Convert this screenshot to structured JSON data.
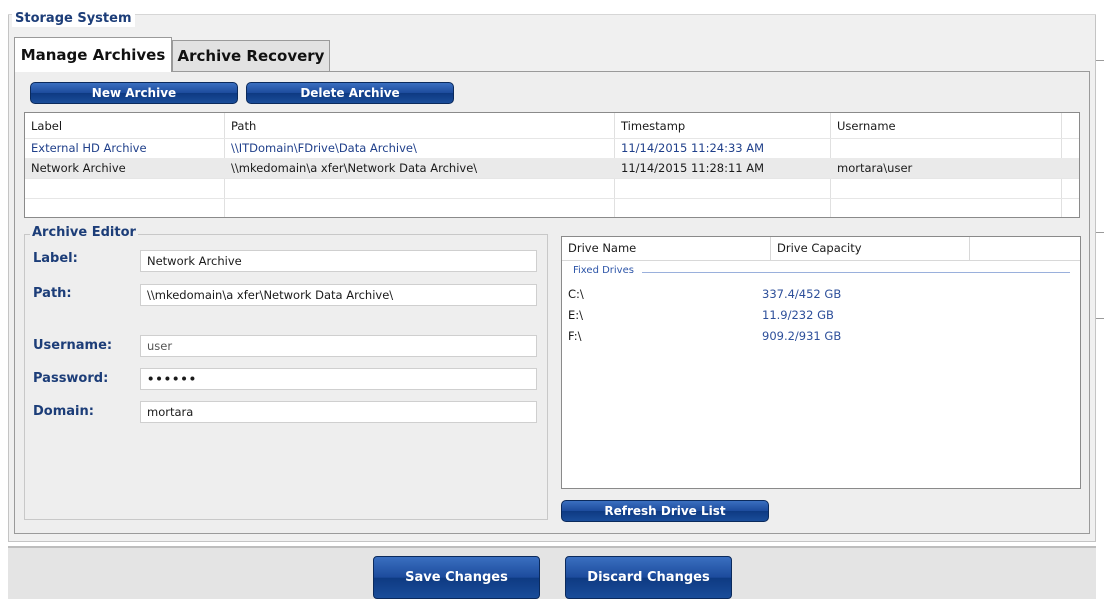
{
  "group_title": "Storage System",
  "tabs": [
    {
      "label": "Manage Archives",
      "active": true
    },
    {
      "label": "Archive Recovery",
      "active": false
    }
  ],
  "toolbar": {
    "new_archive_label": "New Archive",
    "delete_archive_label": "Delete Archive"
  },
  "archive_table": {
    "columns": [
      "Label",
      "Path",
      "Timestamp",
      "Username"
    ],
    "rows": [
      {
        "label": "External HD Archive",
        "path": "\\\\ITDomain\\FDrive\\Data Archive\\",
        "timestamp": "11/14/2015 11:24:33 AM",
        "username": ""
      },
      {
        "label": "Network Archive",
        "path": "\\\\mkedomain\\a xfer\\Network Data Archive\\",
        "timestamp": "11/14/2015 11:28:11 AM",
        "username": "mortara\\user"
      }
    ]
  },
  "editor": {
    "title": "Archive Editor",
    "label_label": "Label:",
    "label_value": "Network Archive",
    "path_label": "Path:",
    "path_value": "\\\\mkedomain\\a xfer\\Network Data Archive\\",
    "username_label": "Username:",
    "username_value": "user",
    "password_label": "Password:",
    "password_value": "••••••",
    "domain_label": "Domain:",
    "domain_value": "mortara"
  },
  "drives": {
    "columns": [
      "Drive Name",
      "Drive Capacity"
    ],
    "group_label": "Fixed Drives",
    "items": [
      {
        "name": "C:\\",
        "capacity": "337.4/452 GB"
      },
      {
        "name": "E:\\",
        "capacity": "11.9/232 GB"
      },
      {
        "name": "F:\\",
        "capacity": "909.2/931 GB"
      }
    ],
    "refresh_label": "Refresh Drive List"
  },
  "footer": {
    "save_label": "Save Changes",
    "discard_label": "Discard Changes"
  },
  "colors": {
    "button_blue": "#1c4b9c",
    "label_blue": "#1c3d78",
    "link_blue": "#1f3f8a"
  }
}
